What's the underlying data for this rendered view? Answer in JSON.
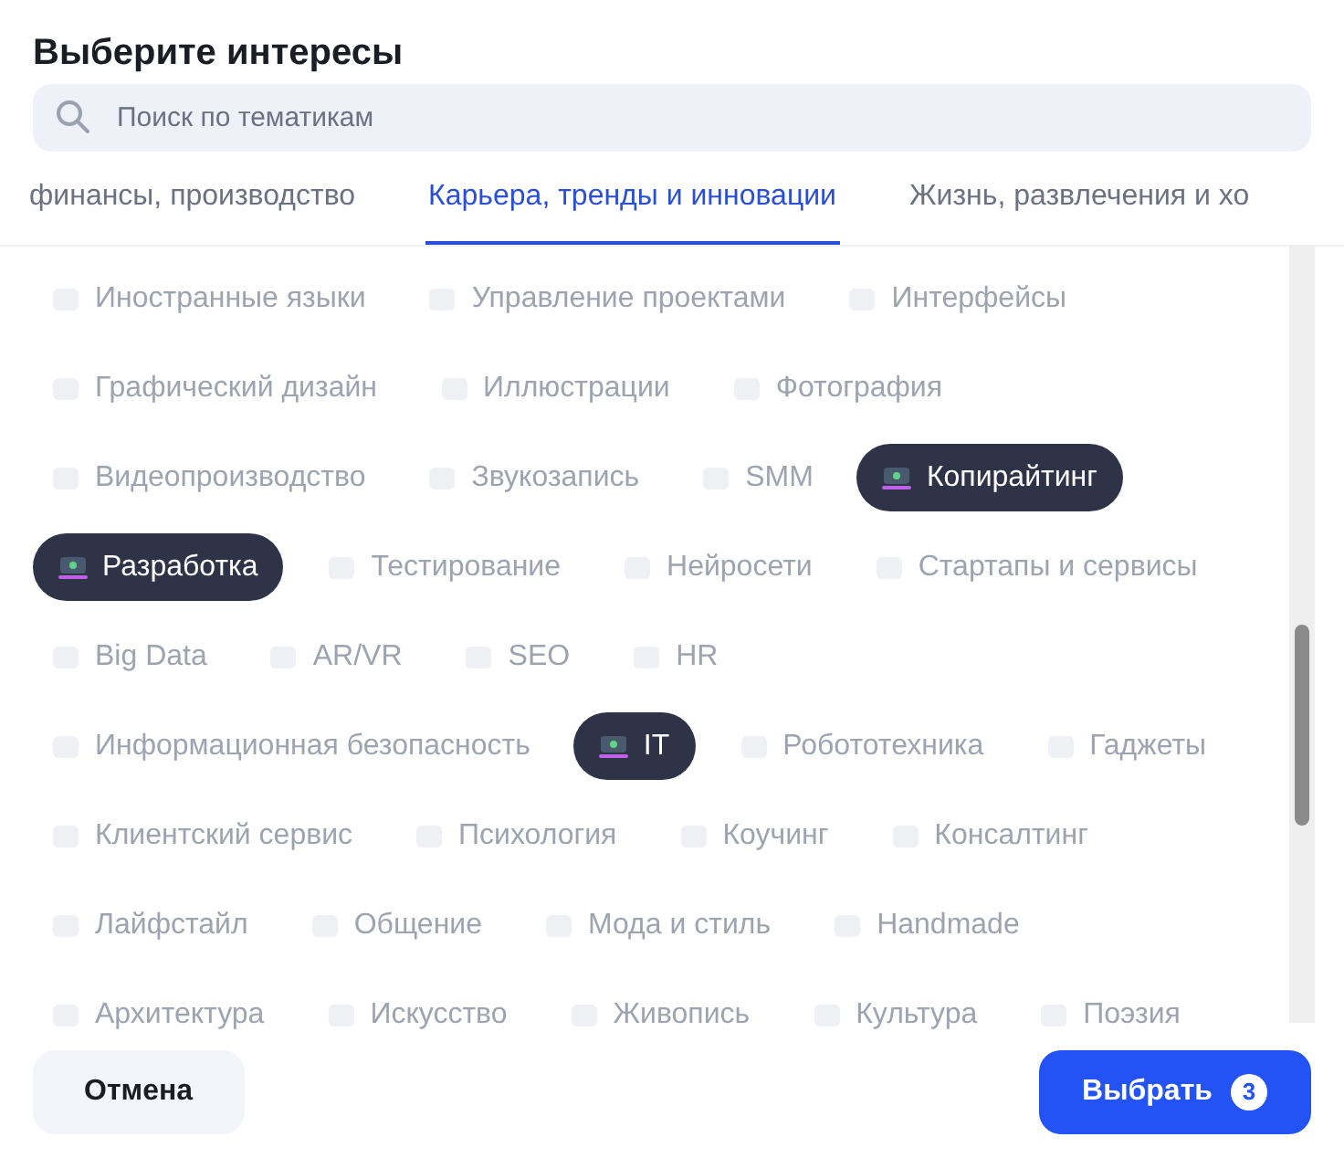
{
  "dialog": {
    "title": "Выберите интересы"
  },
  "search": {
    "placeholder": "Поиск по тематикам"
  },
  "tabs": [
    {
      "label": "финансы, производство",
      "selected": false
    },
    {
      "label": "Карьера, тренды и инновации",
      "selected": true
    },
    {
      "label": "Жизнь, развлечения и хо",
      "selected": false
    }
  ],
  "rows": [
    [
      {
        "label": "Иностранные языки",
        "selected": false
      },
      {
        "label": "Управление проектами",
        "selected": false
      },
      {
        "label": "Интерфейсы",
        "selected": false
      }
    ],
    [
      {
        "label": "Графический дизайн",
        "selected": false
      },
      {
        "label": "Иллюстрации",
        "selected": false
      },
      {
        "label": "Фотография",
        "selected": false
      }
    ],
    [
      {
        "label": "Видеопроизводство",
        "selected": false
      },
      {
        "label": "Звукозапись",
        "selected": false
      },
      {
        "label": "SMM",
        "selected": false
      },
      {
        "label": "Копирайтинг",
        "selected": true
      }
    ],
    [
      {
        "label": "Разработка",
        "selected": true
      },
      {
        "label": "Тестирование",
        "selected": false
      },
      {
        "label": "Нейросети",
        "selected": false
      },
      {
        "label": "Стартапы и сервисы",
        "selected": false
      }
    ],
    [
      {
        "label": "Big Data",
        "selected": false
      },
      {
        "label": "AR/VR",
        "selected": false
      },
      {
        "label": "SEO",
        "selected": false
      },
      {
        "label": "HR",
        "selected": false
      }
    ],
    [
      {
        "label": "Информационная безопасность",
        "selected": false
      },
      {
        "label": "IT",
        "selected": true
      },
      {
        "label": "Робототехника",
        "selected": false
      },
      {
        "label": "Гаджеты",
        "selected": false
      }
    ],
    [
      {
        "label": "Клиентский сервис",
        "selected": false
      },
      {
        "label": "Психология",
        "selected": false
      },
      {
        "label": "Коучинг",
        "selected": false
      },
      {
        "label": "Консалтинг",
        "selected": false
      }
    ],
    [
      {
        "label": "Лайфстайл",
        "selected": false
      },
      {
        "label": "Общение",
        "selected": false
      },
      {
        "label": "Мода и стиль",
        "selected": false
      },
      {
        "label": "Handmade",
        "selected": false
      }
    ],
    [
      {
        "label": "Архитектура",
        "selected": false
      },
      {
        "label": "Искусство",
        "selected": false
      },
      {
        "label": "Живопись",
        "selected": false
      },
      {
        "label": "Культура",
        "selected": false
      },
      {
        "label": "Поэзия",
        "selected": false
      }
    ]
  ],
  "buttons": {
    "cancel": "Отмена",
    "confirm": "Выбрать",
    "count": "3"
  }
}
